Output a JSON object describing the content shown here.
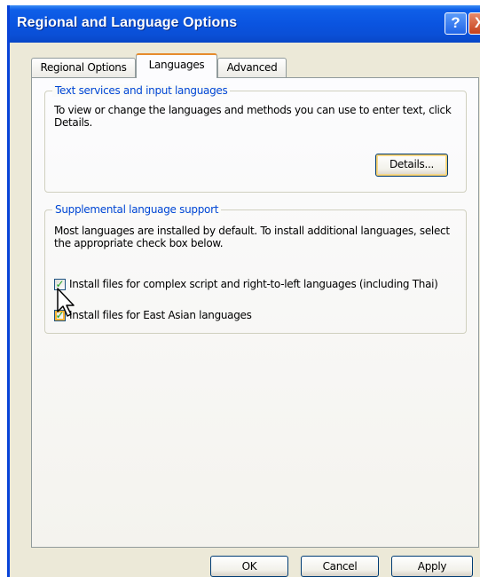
{
  "window": {
    "title": "Regional and Language Options",
    "help_icon": "?",
    "close_icon": "X"
  },
  "tabs": [
    {
      "label": "Regional Options",
      "active": false
    },
    {
      "label": "Languages",
      "active": true
    },
    {
      "label": "Advanced",
      "active": false
    }
  ],
  "text_services": {
    "heading": "Text services and input languages",
    "description": "To view or change the languages and methods you can use to enter text, click Details.",
    "details_button": "Details..."
  },
  "supplemental": {
    "heading": "Supplemental language support",
    "description": "Most languages are installed by default. To install additional languages, select the appropriate check box below.",
    "options": [
      {
        "label": "Install files for complex script and right-to-left languages (including Thai)",
        "checked": true
      },
      {
        "label": "Install files for East Asian languages",
        "checked": true
      }
    ]
  },
  "footer": {
    "ok_label": "OK",
    "cancel_label": "Cancel",
    "apply_label": "Apply"
  },
  "colors": {
    "titlebar": "#0a54e0",
    "group_heading": "#0046d5",
    "active_tab_accent": "#e68b2c",
    "check_mark": "#21a121"
  }
}
